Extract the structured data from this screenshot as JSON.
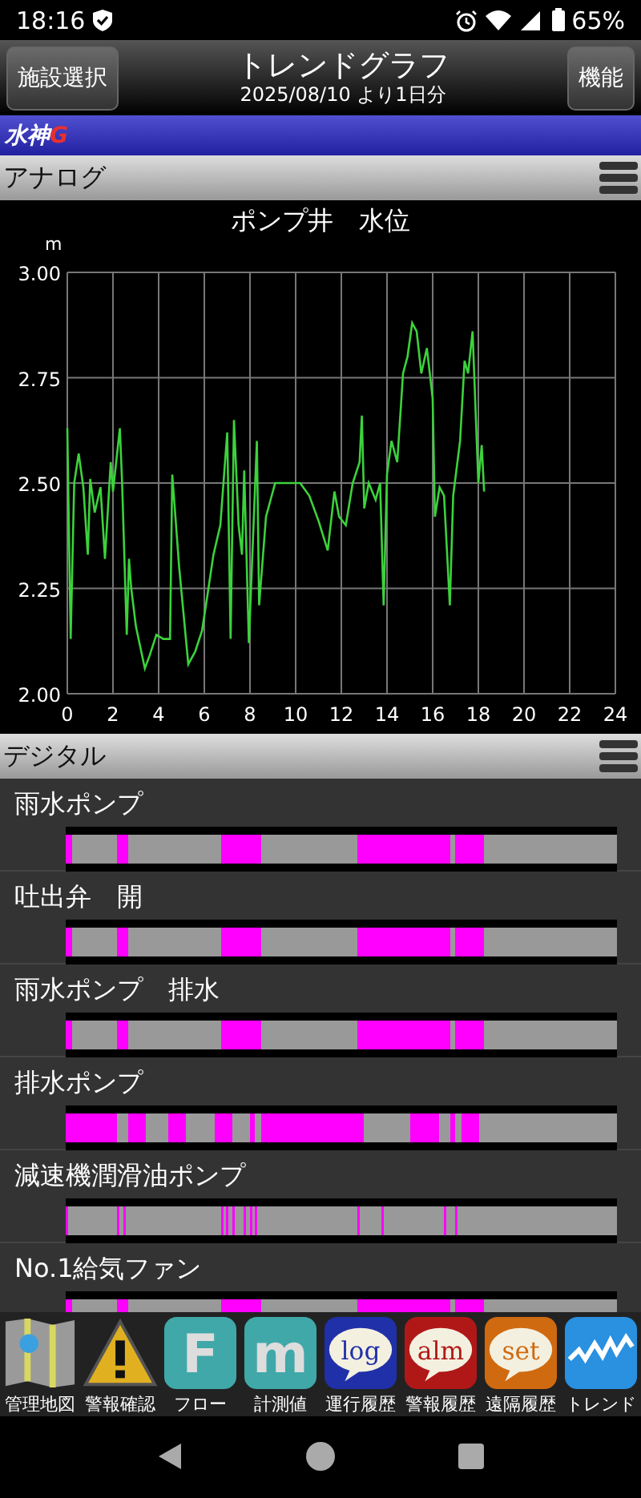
{
  "status_bar": {
    "time": "18:16",
    "battery": "65%"
  },
  "header": {
    "left_button": "施設選択",
    "title": "トレンドグラフ",
    "subtitle": "2025/08/10 より1日分",
    "right_button": "機能"
  },
  "banner": {
    "logo": "水神",
    "logo_mark": "G"
  },
  "analog": {
    "title": "アナログ",
    "chart": {
      "chart_data": {
        "type": "line",
        "title": "ポンプ井　水位",
        "ylabel": "m",
        "grid": true,
        "xlim": [
          0,
          24
        ],
        "ylim": [
          2,
          3
        ],
        "xticks": [
          0,
          2,
          4,
          6,
          8,
          10,
          12,
          14,
          16,
          18,
          20,
          22,
          24
        ],
        "yticks": [
          {
            "value": 2,
            "label": "2.00"
          },
          {
            "value": 2.25,
            "label": "2.25"
          },
          {
            "value": 2.5,
            "label": "2.50"
          },
          {
            "value": 2.75,
            "label": "2.75"
          },
          {
            "value": 3,
            "label": "3.00"
          }
        ],
        "x": [
          0,
          0.15,
          0.3,
          0.5,
          0.7,
          0.9,
          1.0,
          1.2,
          1.45,
          1.65,
          1.9,
          2.0,
          2.3,
          2.4,
          2.6,
          2.7,
          2.8,
          3.0,
          3.2,
          3.4,
          3.6,
          3.9,
          4.2,
          4.5,
          4.6,
          4.9,
          5.3,
          5.6,
          5.9,
          6.1,
          6.4,
          6.7,
          7.0,
          7.15,
          7.3,
          7.5,
          7.65,
          7.75,
          7.95,
          8.3,
          8.4,
          8.7,
          9.1,
          10.2,
          10.6,
          11.0,
          11.4,
          11.7,
          11.9,
          12.2,
          12.5,
          12.8,
          12.9,
          13.0,
          13.2,
          13.5,
          13.7,
          13.85,
          14.0,
          14.2,
          14.45,
          14.7,
          14.9,
          15.1,
          15.3,
          15.5,
          15.75,
          16.0,
          16.1,
          16.3,
          16.5,
          16.75,
          16.9,
          17.2,
          17.4,
          17.55,
          17.75,
          18.0,
          18.15,
          18.25
        ],
        "series": [
          {
            "color": "#3cd23c",
            "values": [
              2.63,
              2.13,
              2.5,
              2.57,
              2.49,
              2.33,
              2.51,
              2.43,
              2.49,
              2.32,
              2.55,
              2.48,
              2.63,
              2.5,
              2.14,
              2.32,
              2.25,
              2.16,
              2.11,
              2.06,
              2.09,
              2.14,
              2.13,
              2.13,
              2.52,
              2.3,
              2.07,
              2.1,
              2.15,
              2.22,
              2.33,
              2.4,
              2.62,
              2.13,
              2.65,
              2.4,
              2.33,
              2.53,
              2.12,
              2.6,
              2.21,
              2.42,
              2.5,
              2.5,
              2.47,
              2.41,
              2.34,
              2.48,
              2.42,
              2.4,
              2.5,
              2.55,
              2.66,
              2.44,
              2.5,
              2.46,
              2.5,
              2.21,
              2.52,
              2.6,
              2.55,
              2.76,
              2.8,
              2.88,
              2.86,
              2.76,
              2.82,
              2.7,
              2.42,
              2.49,
              2.47,
              2.21,
              2.47,
              2.6,
              2.79,
              2.76,
              2.86,
              2.5,
              2.59,
              2.48
            ]
          }
        ]
      }
    }
  },
  "digital": {
    "title": "デジタル",
    "rows": [
      {
        "name": "雨水ポンプ",
        "kind": "block",
        "on": [
          true,
          false,
          false,
          false,
          false,
          false,
          false,
          false,
          false,
          true,
          true,
          false,
          false,
          false,
          false,
          false,
          false,
          false,
          false,
          false,
          false,
          false,
          false,
          false,
          false,
          false,
          false,
          true,
          true,
          true,
          true,
          true,
          true,
          true,
          false,
          false,
          false,
          false,
          false,
          false,
          false,
          false,
          false,
          false,
          false,
          false,
          false,
          false,
          false,
          false,
          false,
          true,
          true,
          true,
          true,
          true,
          true,
          true,
          true,
          true,
          true,
          true,
          true,
          true,
          true,
          true,
          true,
          false,
          true,
          true,
          true,
          true,
          true,
          false,
          false,
          false,
          false,
          false,
          false,
          false,
          false,
          false,
          false,
          false,
          false,
          false,
          false,
          false,
          false,
          false,
          false,
          false,
          false,
          false,
          false,
          false
        ]
      },
      {
        "name": "吐出弁　開",
        "kind": "block",
        "on": [
          true,
          false,
          false,
          false,
          false,
          false,
          false,
          false,
          false,
          true,
          true,
          false,
          false,
          false,
          false,
          false,
          false,
          false,
          false,
          false,
          false,
          false,
          false,
          false,
          false,
          false,
          false,
          true,
          true,
          true,
          true,
          true,
          true,
          true,
          false,
          false,
          false,
          false,
          false,
          false,
          false,
          false,
          false,
          false,
          false,
          false,
          false,
          false,
          false,
          false,
          false,
          true,
          true,
          true,
          true,
          true,
          true,
          true,
          true,
          true,
          true,
          true,
          true,
          true,
          true,
          true,
          true,
          false,
          true,
          true,
          true,
          true,
          true,
          false,
          false,
          false,
          false,
          false,
          false,
          false,
          false,
          false,
          false,
          false,
          false,
          false,
          false,
          false,
          false,
          false,
          false,
          false,
          false,
          false,
          false,
          false
        ]
      },
      {
        "name": "雨水ポンプ　排水",
        "kind": "block",
        "on": [
          true,
          false,
          false,
          false,
          false,
          false,
          false,
          false,
          false,
          true,
          true,
          false,
          false,
          false,
          false,
          false,
          false,
          false,
          false,
          false,
          false,
          false,
          false,
          false,
          false,
          false,
          false,
          true,
          true,
          true,
          true,
          true,
          true,
          true,
          false,
          false,
          false,
          false,
          false,
          false,
          false,
          false,
          false,
          false,
          false,
          false,
          false,
          false,
          false,
          false,
          false,
          true,
          true,
          true,
          true,
          true,
          true,
          true,
          true,
          true,
          true,
          true,
          true,
          true,
          true,
          true,
          true,
          false,
          true,
          true,
          true,
          true,
          true,
          false,
          false,
          false,
          false,
          false,
          false,
          false,
          false,
          false,
          false,
          false,
          false,
          false,
          false,
          false,
          false,
          false,
          false,
          false,
          false,
          false,
          false,
          false
        ]
      },
      {
        "name": "排水ポンプ",
        "kind": "block",
        "on": [
          true,
          true,
          true,
          true,
          true,
          true,
          true,
          true,
          true,
          false,
          false,
          true,
          true,
          true,
          false,
          false,
          false,
          false,
          true,
          true,
          true,
          false,
          false,
          false,
          false,
          false,
          true,
          true,
          true,
          false,
          false,
          false,
          true,
          false,
          true,
          true,
          true,
          true,
          true,
          true,
          true,
          true,
          true,
          true,
          true,
          true,
          true,
          true,
          true,
          true,
          true,
          true,
          false,
          false,
          false,
          false,
          false,
          false,
          false,
          false,
          true,
          true,
          true,
          true,
          true,
          false,
          false,
          true,
          false,
          true,
          true,
          true,
          false,
          false,
          false,
          false,
          false,
          false,
          false,
          false,
          false,
          false,
          false,
          false,
          false,
          false,
          false,
          false,
          false,
          false,
          false,
          false,
          false,
          false,
          false,
          false
        ]
      },
      {
        "name": "減速機潤滑油ポンプ",
        "kind": "pulse",
        "on": [
          true,
          false,
          false,
          false,
          false,
          false,
          false,
          false,
          false,
          true,
          true,
          false,
          false,
          false,
          false,
          false,
          false,
          false,
          false,
          false,
          false,
          false,
          false,
          false,
          false,
          false,
          false,
          true,
          true,
          true,
          false,
          true,
          true,
          true,
          false,
          false,
          false,
          false,
          false,
          false,
          false,
          false,
          false,
          false,
          false,
          false,
          false,
          false,
          false,
          false,
          false,
          true,
          false,
          false,
          false,
          true,
          false,
          false,
          false,
          false,
          false,
          false,
          false,
          false,
          false,
          false,
          true,
          false,
          true,
          false,
          false,
          false,
          false,
          false,
          false,
          false,
          false,
          false,
          false,
          false,
          false,
          false,
          false,
          false,
          false,
          false,
          false,
          false,
          false,
          false,
          false,
          false,
          false,
          false,
          false,
          false
        ]
      },
      {
        "name": "No.1給気ファン",
        "kind": "block",
        "on": [
          true,
          false,
          false,
          false,
          false,
          false,
          false,
          false,
          false,
          true,
          true,
          false,
          false,
          false,
          false,
          false,
          false,
          false,
          false,
          false,
          false,
          false,
          false,
          false,
          false,
          false,
          false,
          true,
          true,
          true,
          true,
          true,
          true,
          true,
          false,
          false,
          false,
          false,
          false,
          false,
          false,
          false,
          false,
          false,
          false,
          false,
          false,
          false,
          false,
          false,
          false,
          true,
          true,
          true,
          true,
          true,
          true,
          true,
          true,
          true,
          true,
          true,
          true,
          true,
          true,
          true,
          true,
          false,
          true,
          true,
          true,
          true,
          true,
          false,
          false,
          false,
          false,
          false,
          false,
          false,
          false,
          false,
          false,
          false,
          false,
          false,
          false,
          false,
          false,
          false,
          false,
          false,
          false,
          false,
          false,
          false
        ]
      }
    ]
  },
  "toolbar": [
    {
      "kind": "map",
      "label": "管理地図"
    },
    {
      "kind": "warning",
      "label": "警報確認"
    },
    {
      "kind": "letter",
      "glyph": "F",
      "label": "フロー"
    },
    {
      "kind": "letter",
      "glyph": "m",
      "label": "計測値"
    },
    {
      "kind": "bubble",
      "glyph": "log",
      "color": "#2030a8",
      "label": "運行履歴"
    },
    {
      "kind": "bubble",
      "glyph": "alm",
      "color": "#b01818",
      "label": "警報履歴"
    },
    {
      "kind": "bubble",
      "glyph": "set",
      "color": "#d06a10",
      "label": "遠隔履歴"
    },
    {
      "kind": "wave",
      "label": "トレンド"
    }
  ]
}
